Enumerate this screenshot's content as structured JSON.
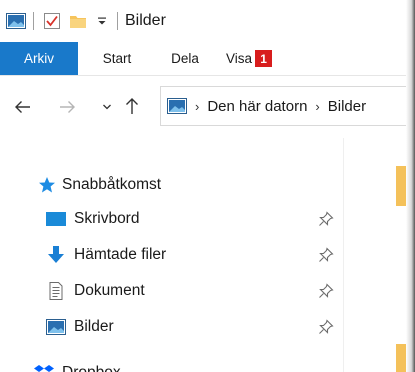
{
  "window": {
    "title": "Bilder"
  },
  "quick_access_toolbar": {
    "icons": [
      "pictures-folder-icon",
      "properties-checkmark-icon",
      "folder-icon",
      "customize-toolbar-dropdown-icon"
    ]
  },
  "ribbon": {
    "tabs": [
      {
        "label": "Arkiv"
      },
      {
        "label": "Start"
      },
      {
        "label": "Dela"
      },
      {
        "label": "Visa",
        "badge": "1"
      }
    ],
    "file_tab_color": "#1979ca",
    "badge_color": "#d81d1d"
  },
  "navigation": {
    "back_icon": "arrow-left-icon",
    "forward_icon": "arrow-right-icon",
    "recent_icon": "chevron-down-icon",
    "up_icon": "arrow-up-icon"
  },
  "address_bar": {
    "breadcrumbs": [
      "Den här datorn",
      "Bilder"
    ]
  },
  "nav_pane": {
    "quick_access_label": "Snabbåtkomst",
    "items": [
      {
        "label": "Skrivbord",
        "icon": "desktop-icon",
        "pinned": true
      },
      {
        "label": "Hämtade filer",
        "icon": "download-arrow-icon",
        "pinned": true
      },
      {
        "label": "Dokument",
        "icon": "document-icon",
        "pinned": true
      },
      {
        "label": "Bilder",
        "icon": "pictures-icon",
        "pinned": true
      }
    ],
    "partial_item_label": "Dropbox"
  },
  "colors": {
    "accent": "#1979ca",
    "star": "#1e8ce3",
    "folder": "#f4c15a"
  }
}
